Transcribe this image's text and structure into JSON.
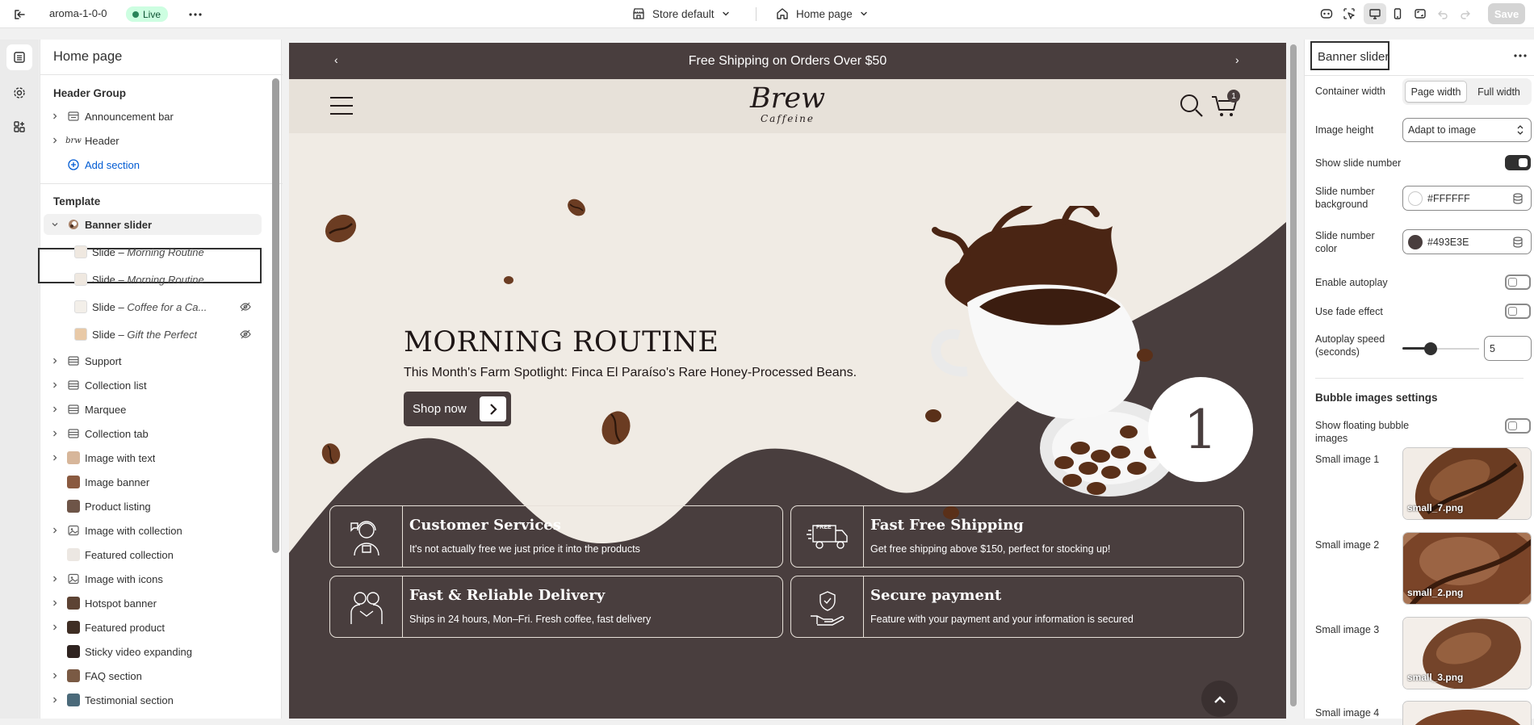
{
  "topbar": {
    "theme_name": "aroma-1-0-0",
    "status_badge": "Live",
    "store_selector": "Store default",
    "page_selector": "Home page",
    "save_label": "Save"
  },
  "sidebar": {
    "title": "Home page",
    "header_group_title": "Header Group",
    "header_items": [
      {
        "label": "Announcement bar"
      },
      {
        "label": "Header"
      }
    ],
    "add_section": "Add section",
    "template_title": "Template",
    "selected_item": "Banner slider",
    "slides": [
      {
        "prefix": "Slide – ",
        "name": "Morning Routine",
        "hidden": false
      },
      {
        "prefix": "Slide – ",
        "name": "Morning Routine",
        "hidden": false
      },
      {
        "prefix": "Slide – ",
        "name": "Coffee for a Ca...",
        "hidden": true
      },
      {
        "prefix": "Slide – ",
        "name": "Gift the Perfect",
        "hidden": true
      }
    ],
    "template_items": [
      {
        "label": "Support"
      },
      {
        "label": "Collection list"
      },
      {
        "label": "Marquee"
      },
      {
        "label": "Collection tab"
      },
      {
        "label": "Image with text"
      },
      {
        "label": "Image banner"
      },
      {
        "label": "Product listing"
      },
      {
        "label": "Image with collection"
      },
      {
        "label": "Featured collection"
      },
      {
        "label": "Image with icons"
      },
      {
        "label": "Hotspot banner"
      },
      {
        "label": "Featured product"
      },
      {
        "label": "Sticky video expanding"
      },
      {
        "label": "FAQ section"
      },
      {
        "label": "Testimonial section"
      }
    ]
  },
  "preview": {
    "announcement": "Free Shipping on Orders Over $50",
    "logo_main": "Brew",
    "logo_sub": "Caffeine",
    "cart_count": "1",
    "hero_title": "MORNING ROUTINE",
    "hero_subtitle": "This Month's Farm Spotlight: Finca El Paraíso's Rare Honey-Processed Beans.",
    "hero_button": "Shop now",
    "slide_number": "1",
    "features": [
      {
        "title": "Customer Services",
        "desc": "It's not actually free we just price it into the products"
      },
      {
        "title": "Fast Free Shipping",
        "desc": "Get free shipping above $150, perfect for stocking up!"
      },
      {
        "title": "Fast & Reliable Delivery",
        "desc": "Ships in 24 hours, Mon–Fri. Fresh coffee, fast delivery"
      },
      {
        "title": "Secure payment",
        "desc": "Feature with your payment and your information is secured"
      }
    ],
    "truck_label": "FREE",
    "colors": {
      "dark": "#493e3e",
      "cream": "#f0ebe4"
    }
  },
  "settings": {
    "title": "Banner slider",
    "container_width_label": "Container width",
    "container_width_options": [
      "Page width",
      "Full width"
    ],
    "container_width_selected": "Page width",
    "image_height_label": "Image height",
    "image_height_value": "Adapt to image",
    "show_slide_number_label": "Show slide number",
    "show_slide_number": true,
    "slide_number_bg_label": "Slide number background",
    "slide_number_bg_value": "#FFFFFF",
    "slide_number_color_label": "Slide number color",
    "slide_number_color_value": "#493E3E",
    "enable_autoplay_label": "Enable autoplay",
    "enable_autoplay": false,
    "fade_effect_label": "Use fade effect",
    "fade_effect": false,
    "autoplay_speed_label": "Autoplay speed (seconds)",
    "autoplay_speed_value": "5",
    "autoplay_speed_fraction": 0.34,
    "bubble_section_title": "Bubble images settings",
    "floating_bubble_label": "Show floating bubble images",
    "floating_bubble": false,
    "small_images": [
      {
        "label": "Small image 1",
        "file": "small_7.png"
      },
      {
        "label": "Small image 2",
        "file": "small_2.png"
      },
      {
        "label": "Small image 3",
        "file": "small_3.png"
      },
      {
        "label": "Small image 4",
        "file": ""
      }
    ]
  }
}
